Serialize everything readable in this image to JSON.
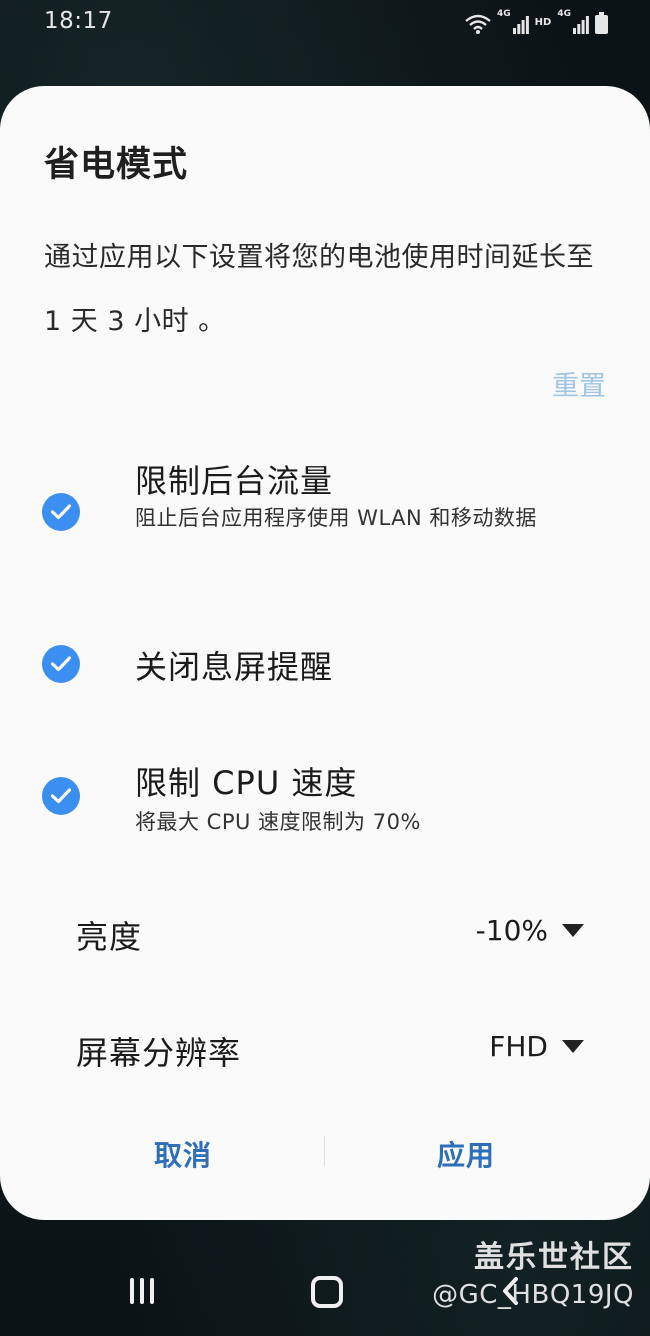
{
  "status_bar": {
    "time": "18:17",
    "net_badge_1": "4G",
    "hd_badge": "HD",
    "net_badge_2": "4G"
  },
  "dialog": {
    "title": "省电模式",
    "description": "通过应用以下设置将您的电池使用时间延长至 1 天 3 小时 。",
    "reset_label": "重置",
    "options": [
      {
        "title": "限制后台流量",
        "subtitle": "阻止后台应用程序使用 WLAN 和移动数据",
        "checked": true
      },
      {
        "title": "关闭息屏提醒",
        "subtitle": "",
        "checked": true
      },
      {
        "title": "限制 CPU 速度",
        "subtitle": "将最大 CPU 速度限制为 70%",
        "checked": true
      }
    ],
    "brightness": {
      "label": "亮度",
      "value": "-10%"
    },
    "resolution": {
      "label": "屏幕分辨率",
      "value": "FHD"
    },
    "cancel_label": "取消",
    "apply_label": "应用"
  },
  "watermark": {
    "title": "盖乐世社区",
    "user": "@GC_HBQ19JQ"
  },
  "colors": {
    "accent": "#3b8ff1",
    "button_text": "#2d6fb8",
    "reset_text": "#9ec5e3"
  }
}
